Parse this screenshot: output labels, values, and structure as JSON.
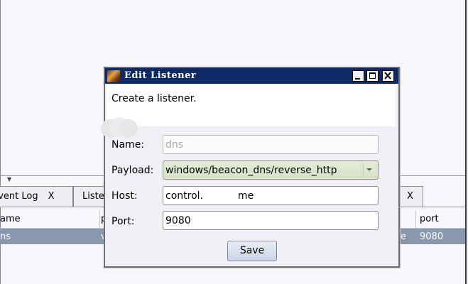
{
  "background": {
    "tabs": [
      {
        "label": "Event Log",
        "close": "X"
      },
      {
        "label": "Liste"
      },
      {
        "close": "X"
      }
    ],
    "table": {
      "headers": [
        "ame",
        "p",
        "port"
      ],
      "rows": [
        {
          "name": "ns",
          "col2": "v",
          "col3": "e",
          "port": "9080"
        }
      ]
    }
  },
  "dialog": {
    "title": "Edit Listener",
    "description": "Create a listener.",
    "fields": {
      "name": {
        "label": "Name:",
        "value": "dns"
      },
      "payload": {
        "label": "Payload:",
        "value": "windows/beacon_dns/reverse_http"
      },
      "host": {
        "label": "Host:",
        "value": "control.           me"
      },
      "port": {
        "label": "Port:",
        "value": "9080"
      }
    },
    "save_label": "Save"
  },
  "colors": {
    "titlebar": "#0d2a66",
    "selected_row": "#8a97ad",
    "payload_bg": "#dfe8d0"
  }
}
